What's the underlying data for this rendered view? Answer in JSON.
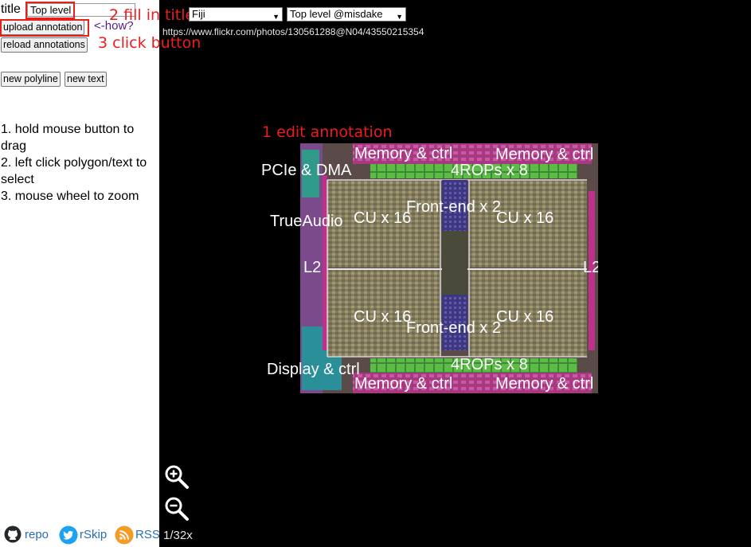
{
  "sidebar": {
    "title_label": "title",
    "title_value": "Top level",
    "upload_button": "upload annotation",
    "how_link": "<-how?",
    "reload_button": "reload annotations",
    "new_polyline_button": "new polyline",
    "new_text_button": "new text",
    "instructions": [
      "1. hold mouse button to drag",
      "2. left click polygon/text to select",
      "3. mouse wheel to zoom"
    ],
    "footer": {
      "repo": "repo",
      "rskip": "rSkip",
      "rss": "RSS"
    }
  },
  "guides": {
    "step1": "1 edit annotation",
    "step2": "2 fill in title",
    "step3": "3 click button"
  },
  "viewer": {
    "chip_select": "Fiji",
    "annotation_select": "Top level @misdake",
    "source_url": "https://www.flickr.com/photos/130561288@N04/43550215354",
    "zoom_level": "1/32x",
    "annotations": {
      "mem_tl": "Memory & ctrl",
      "mem_tr": "Memory & ctrl",
      "mem_bl": "Memory & ctrl",
      "mem_br": "Memory & ctrl",
      "pcie": "PCIe & DMA",
      "rops_top": "4ROPs x 8",
      "rops_bottom": "4ROPs x 8",
      "trueaudio": "TrueAudio",
      "cu_tl": "CU x 16",
      "cu_tr": "CU x 16",
      "cu_bl": "CU x 16",
      "cu_br": "CU x 16",
      "fe_top": "Front-end x 2",
      "fe_bottom": "Front-end x 2",
      "l2_left": "L2",
      "l2_right": "L2",
      "display": "Display & ctrl"
    }
  },
  "colors": {
    "guide_red": "#ee1c1c",
    "link_purple": "#551a8b",
    "die_magenta": "#b0308a",
    "die_green": "#4cae3a",
    "die_gold": "#b09a4a"
  }
}
